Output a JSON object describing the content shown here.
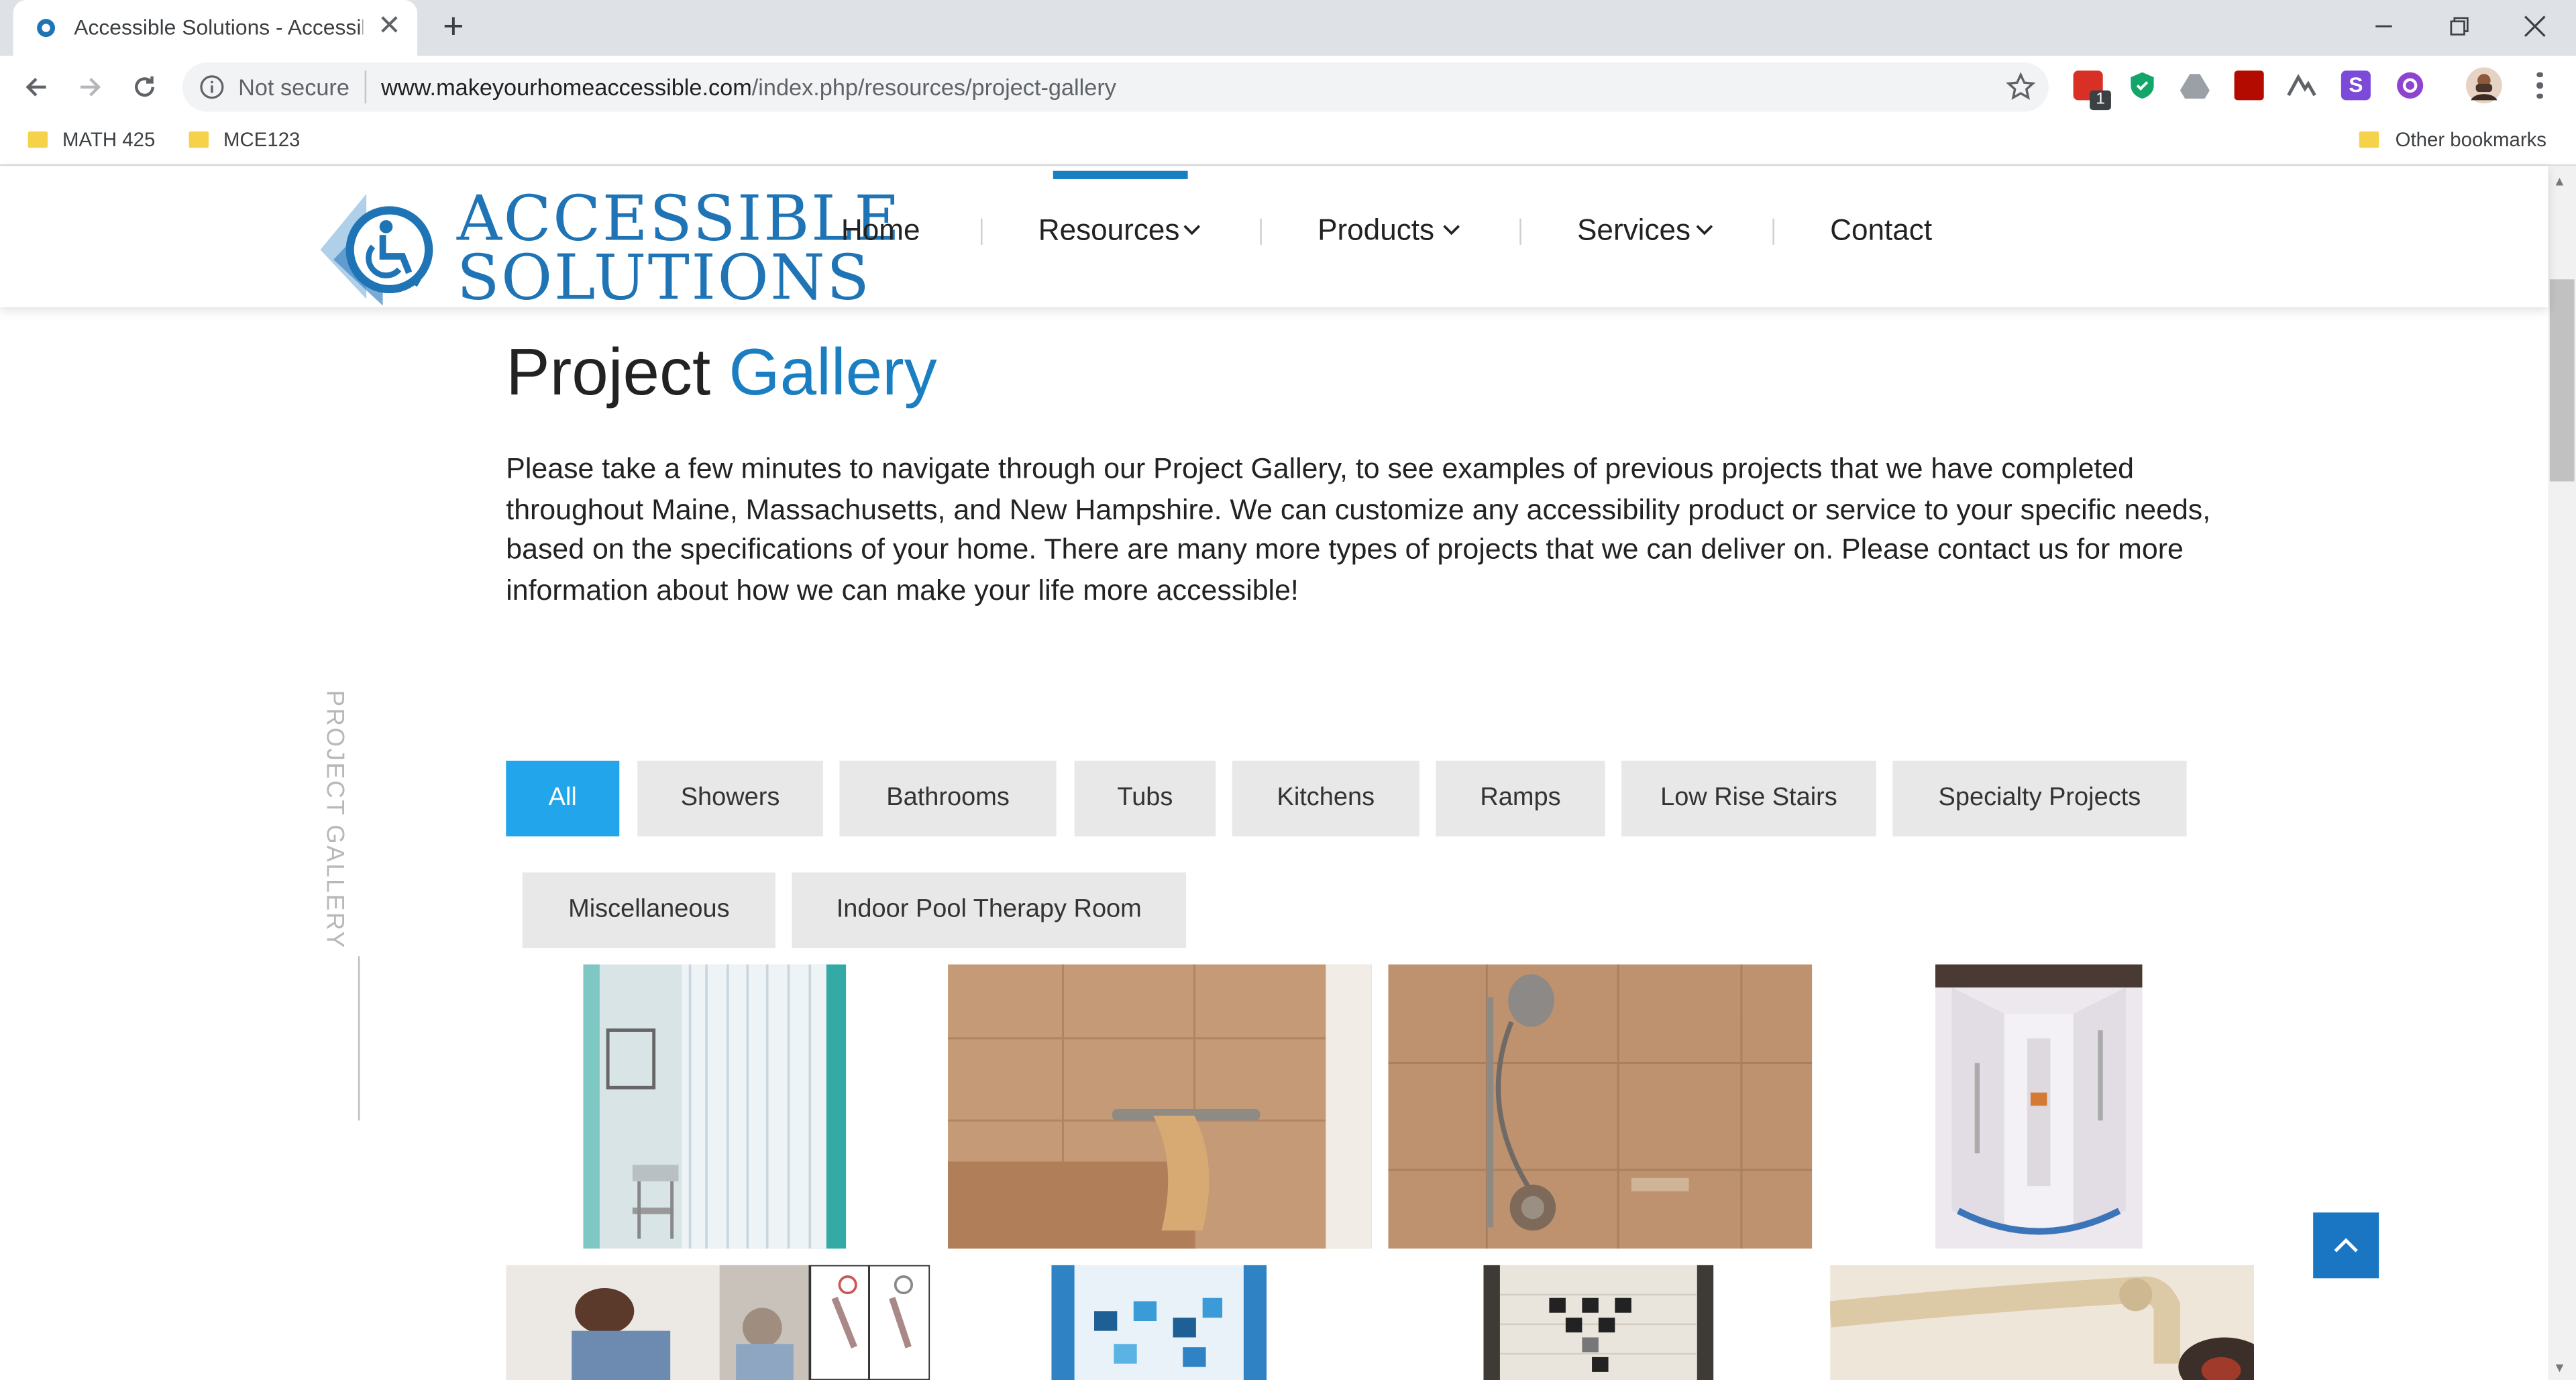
{
  "browser": {
    "tab_title": "Accessible Solutions - Accessible",
    "security_label": "Not secure",
    "url_host": "www.makeyourhomeaccessible.com",
    "url_path": "/index.php/resources/project-gallery",
    "ext_badge": "1",
    "ext_letter": "S",
    "bookmarks": [
      {
        "label": "MATH 425"
      },
      {
        "label": "MCE123"
      }
    ],
    "other_bookmarks": "Other bookmarks"
  },
  "site": {
    "logo_line1": "ACCESSIBLE",
    "logo_line2": "SOLUTIONS",
    "nav": [
      {
        "label": "Home"
      },
      {
        "label": "Resources"
      },
      {
        "label": "Products"
      },
      {
        "label": "Services"
      },
      {
        "label": "Contact"
      }
    ],
    "active_nav": "Resources"
  },
  "page": {
    "side_label": "PROJECT GALLERY",
    "title_plain": "Project",
    "title_accent": "Gallery",
    "intro": "Please take a few minutes to navigate through our Project Gallery, to see examples of previous projects that we have completed throughout Maine, Massachusetts, and New Hampshire. We can customize any accessibility product or service to your specific needs, based on the specifications of your home. There are many more types of projects that we can deliver on. Please contact us for more information about how we can make your life more accessible!",
    "filters": [
      {
        "label": "All",
        "active": true
      },
      {
        "label": "Showers"
      },
      {
        "label": "Bathrooms"
      },
      {
        "label": "Tubs"
      },
      {
        "label": "Kitchens"
      },
      {
        "label": "Ramps"
      },
      {
        "label": "Low Rise Stairs"
      },
      {
        "label": "Specialty Projects"
      },
      {
        "label": "Miscellaneous"
      },
      {
        "label": "Indoor Pool Therapy Room"
      }
    ]
  },
  "colors": {
    "accent": "#1a7ec2",
    "filter_active": "#22a5ea",
    "filter_bg": "#e8e8e8",
    "back_to_top": "#1a75c2"
  }
}
